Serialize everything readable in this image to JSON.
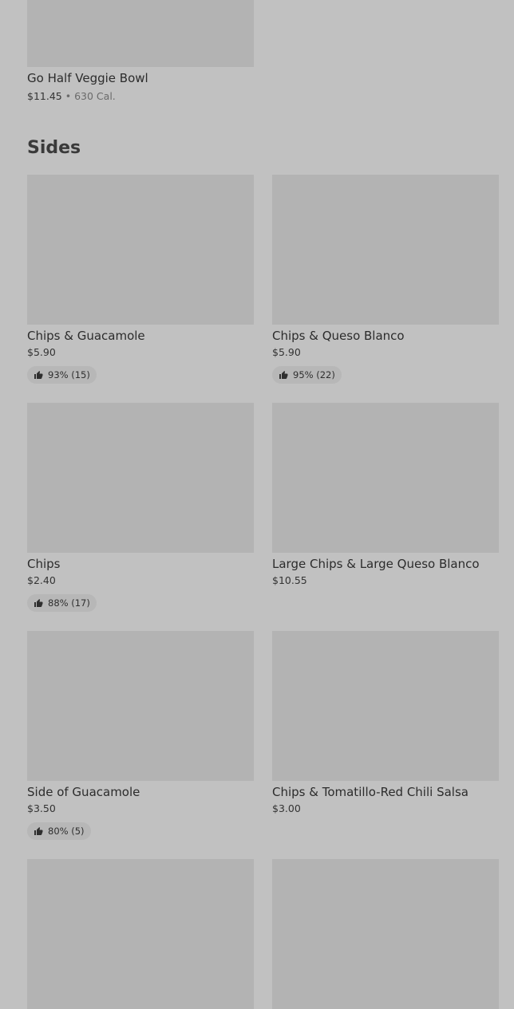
{
  "top_item": {
    "name": "Go Half Veggie Bowl",
    "price": "$11.45",
    "separator": "•",
    "calories": "630 Cal."
  },
  "section": {
    "title": "Sides"
  },
  "items": [
    {
      "name": "Chips & Guacamole",
      "price": "$5.90",
      "rating": "93% (15)"
    },
    {
      "name": "Chips & Queso Blanco",
      "price": "$5.90",
      "rating": "95% (22)"
    },
    {
      "name": "Chips",
      "price": "$2.40",
      "rating": "88% (17)"
    },
    {
      "name": "Large Chips & Large Queso Blanco",
      "price": "$10.55",
      "rating": ""
    },
    {
      "name": "Side of Guacamole",
      "price": "$3.50",
      "rating": "80% (5)"
    },
    {
      "name": "Chips & Tomatillo-Red Chili Salsa",
      "price": "$3.00",
      "rating": ""
    },
    {
      "name": "",
      "price": "",
      "rating": ""
    },
    {
      "name": "",
      "price": "",
      "rating": ""
    }
  ],
  "icons": {
    "thumbs_up": "thumbs-up-icon"
  }
}
